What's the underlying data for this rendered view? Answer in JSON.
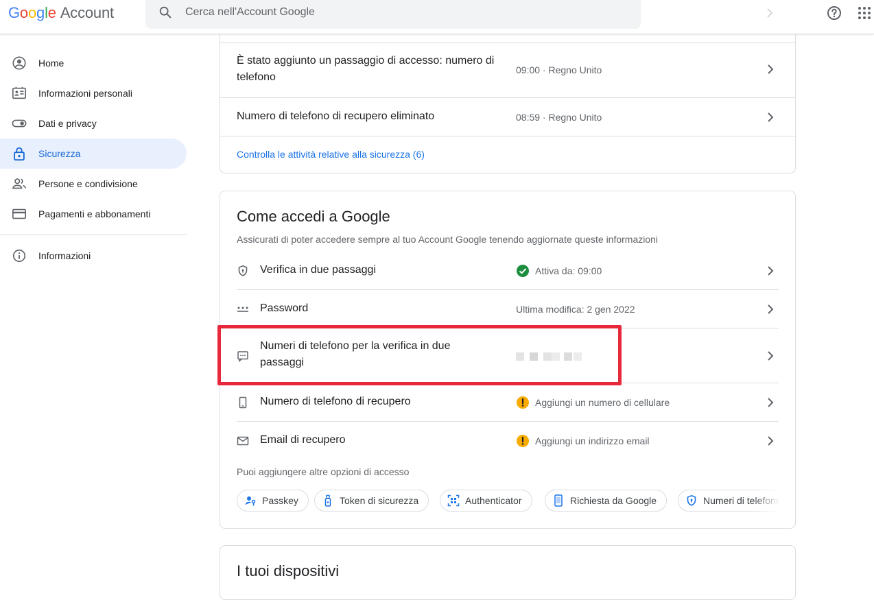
{
  "header": {
    "logo": {
      "g1": "G",
      "g2": "o",
      "g3": "o",
      "g4": "g",
      "g5": "l",
      "g6": "e",
      "product": "Account"
    },
    "search_placeholder": "Cerca nell'Account Google",
    "icons": [
      "search-icon",
      "help-icon",
      "apps-icon"
    ]
  },
  "sidebar": {
    "items": [
      {
        "label": "Home",
        "icon": "account-circle-icon"
      },
      {
        "label": "Informazioni personali",
        "icon": "id-card-icon"
      },
      {
        "label": "Dati e privacy",
        "icon": "toggle-icon"
      },
      {
        "label": "Sicurezza",
        "icon": "lock-icon",
        "active": true
      },
      {
        "label": "Persone e condivisione",
        "icon": "people-icon"
      },
      {
        "label": "Pagamenti e abbonamenti",
        "icon": "credit-card-icon"
      },
      {
        "label": "Informazioni",
        "icon": "info-icon"
      }
    ]
  },
  "activity": {
    "rows": [
      {
        "title": "È stato aggiunto un passaggio di accesso: numero di telefono",
        "meta": "09:00 · Regno Unito"
      },
      {
        "title": "Numero di telefono di recupero eliminato",
        "meta": "08:59 · Regno Unito"
      }
    ],
    "link": "Controlla le attività relative alla sicurezza (6)"
  },
  "signin": {
    "title": "Come accedi a Google",
    "subtitle": "Assicurati di poter accedere sempre al tuo Account Google tenendo aggiornate queste informazioni",
    "rows": [
      {
        "label": "Verifica in due passaggi",
        "meta": "Attiva da: 09:00",
        "icon": "shield-icon",
        "status": "check-circle-icon"
      },
      {
        "label": "Password",
        "meta": "Ultima modifica: 2 gen 2022",
        "icon": "password-dots-icon"
      },
      {
        "label": "Numeri di telefono per la verifica in due passaggi",
        "icon": "sms-icon"
      },
      {
        "label": "Numero di telefono di recupero",
        "meta": "Aggiungi un numero di cellulare",
        "icon": "phone-icon",
        "status": "warning-icon"
      },
      {
        "label": "Email di recupero",
        "meta": "Aggiungi un indirizzo email",
        "icon": "mail-icon",
        "status": "warning-icon"
      }
    ],
    "more_label": "Puoi aggiungere altre opzioni di accesso",
    "chips": [
      {
        "label": "Passkey",
        "icon": "passkey-icon"
      },
      {
        "label": "Token di sicurezza",
        "icon": "security-key-icon"
      },
      {
        "label": "Authenticator",
        "icon": "qr-scan-icon"
      },
      {
        "label": "Richiesta da Google",
        "icon": "phone-prompt-icon"
      },
      {
        "label": "Numeri di telefono",
        "icon": "shield-icon"
      }
    ]
  },
  "devices": {
    "title": "I tuoi dispositivi"
  },
  "colors": {
    "accent": "#1a73e8",
    "active_bg": "#e8f0fe",
    "highlight": "#e8293b",
    "ok": "#1e8e3e",
    "warn": "#f9ab00"
  }
}
